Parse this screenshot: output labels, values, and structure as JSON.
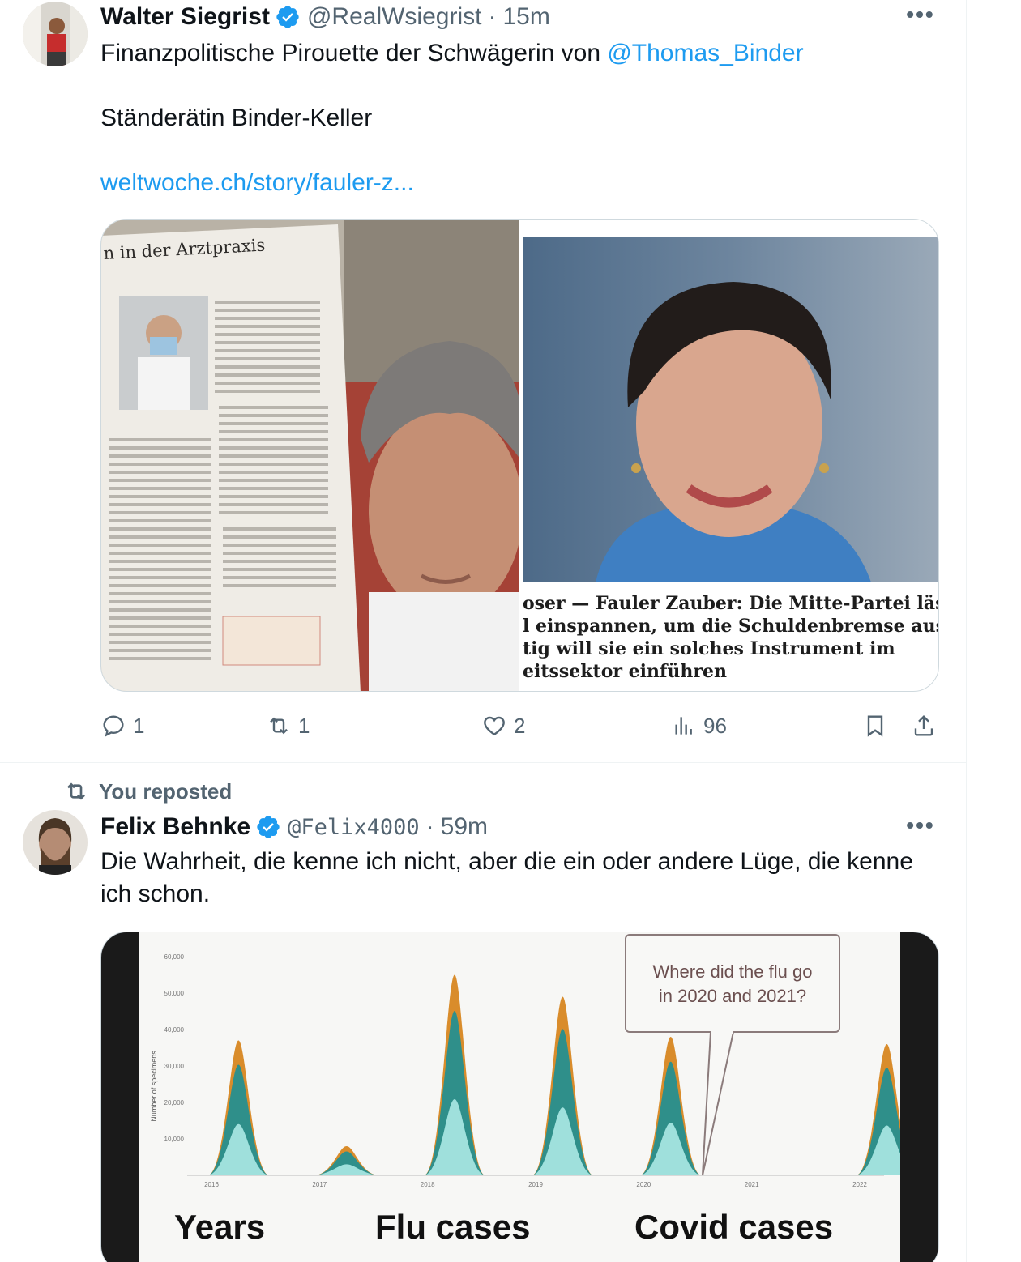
{
  "tweets": [
    {
      "author": "Walter Siegrist",
      "handle": "@RealWsiegrist",
      "separator": "·",
      "time": "15m",
      "text_prefix": "Finanzpolitische Pirouette der Schwägerin von ",
      "mention": "@Thomas_Binder",
      "line2": "Ständerätin Binder-Keller",
      "url": "weltwoche.ch/story/fauler-z...",
      "media": {
        "newspaper_heading": "n in der Arztpraxis",
        "caption_lines": [
          "oser — Fauler Zauber: Die Mitte-Partei lässt",
          "l einspannen, um die Schuldenbremse aus",
          "tig will sie ein solches Instrument im",
          "eitssektor einführen"
        ]
      },
      "stats": {
        "replies": "1",
        "reposts": "1",
        "likes": "2",
        "views": "96"
      }
    },
    {
      "repost_label": "You reposted",
      "author": "Felix Behnke",
      "handle": "@Felix4000",
      "separator": "·",
      "time": "59m",
      "text": "Die Wahrheit, die kenne ich nicht, aber die ein oder andere Lüge, die kenne ich schon.",
      "media": {
        "speech_bubble": [
          "Where did the flu go",
          "in 2020 and 2021?"
        ],
        "bottom_labels": [
          "Years",
          "Flu cases",
          "Covid cases"
        ]
      }
    }
  ],
  "chart_data": {
    "type": "area",
    "title": "",
    "ylabel": "Number of specimens",
    "ylim": [
      0,
      60000
    ],
    "yticks": [
      10000,
      20000,
      30000,
      40000,
      50000,
      60000
    ],
    "x": [
      "2016",
      "2017",
      "2018",
      "2019",
      "2020",
      "2021",
      "2022"
    ],
    "series": [
      {
        "name": "",
        "values": [
          37000,
          8000,
          55000,
          49000,
          38000,
          0,
          36000
        ]
      }
    ]
  },
  "colors": {
    "link": "#1d9bf0",
    "verified": "#1d9bf0",
    "secondary_text": "#536471",
    "border": "#cfd9de",
    "chart_orange": "#d98c2b",
    "chart_teal": "#2f8f8a",
    "chart_light": "#9fe0dc"
  },
  "icons": [
    "verified-badge-icon",
    "more-icon",
    "reply-icon",
    "repost-icon",
    "like-icon",
    "views-icon",
    "bookmark-icon",
    "share-icon"
  ]
}
